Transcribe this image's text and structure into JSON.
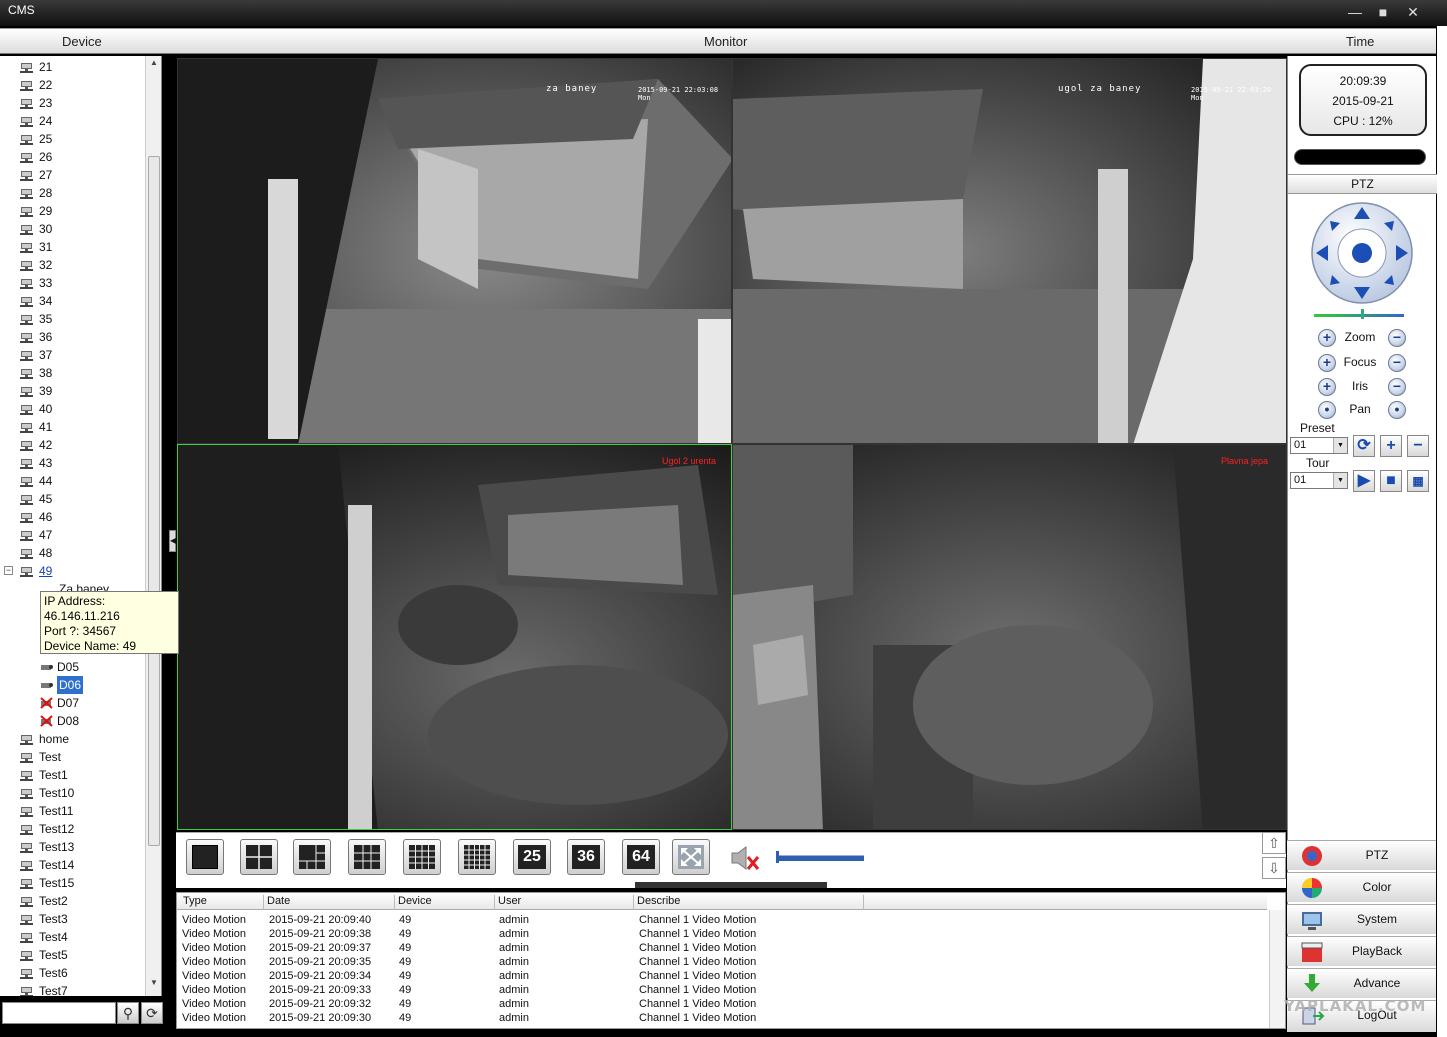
{
  "window": {
    "title": "CMS"
  },
  "header": {
    "device": "Device",
    "monitor": "Monitor",
    "time": "Time"
  },
  "tree": {
    "items": [
      "21",
      "22",
      "23",
      "24",
      "25",
      "26",
      "27",
      "28",
      "29",
      "30",
      "31",
      "32",
      "33",
      "34",
      "35",
      "36",
      "37",
      "38",
      "39",
      "40",
      "41",
      "42",
      "43",
      "44",
      "45",
      "46",
      "47",
      "48"
    ],
    "expanded": "49",
    "expanded_child": "Za baney",
    "channels": [
      "D05",
      "D06",
      "D07",
      "D08"
    ],
    "selected": "D06",
    "after": [
      "home",
      "Test",
      "Test1",
      "Test10",
      "Test11",
      "Test12",
      "Test13",
      "Test14",
      "Test15",
      "Test2",
      "Test3",
      "Test4",
      "Test5",
      "Test6",
      "Test7"
    ]
  },
  "tooltip": {
    "ip": "IP Address: 46.146.11.216",
    "port": "Port ?: 34567",
    "name": "Device Name: 49"
  },
  "cameras": [
    {
      "name": "za baney",
      "time": "2015-09-21 22:03:08 Mon"
    },
    {
      "name": "ugol za baney",
      "time": "2015-09-21 22:03:20 Mon"
    },
    {
      "name": "Ugol 2 urenta",
      "time": ""
    },
    {
      "name": "Plavna jepa",
      "time": ""
    }
  ],
  "layouts": [
    "25",
    "36",
    "64"
  ],
  "log": {
    "columns": [
      "Type",
      "Date",
      "Device",
      "User",
      "Describe"
    ],
    "rows": [
      [
        "Video Motion",
        "2015-09-21 20:09:40",
        "49",
        "admin",
        "Channel 1 Video Motion"
      ],
      [
        "Video Motion",
        "2015-09-21 20:09:38",
        "49",
        "admin",
        "Channel 1 Video Motion"
      ],
      [
        "Video Motion",
        "2015-09-21 20:09:37",
        "49",
        "admin",
        "Channel 1 Video Motion"
      ],
      [
        "Video Motion",
        "2015-09-21 20:09:35",
        "49",
        "admin",
        "Channel 1 Video Motion"
      ],
      [
        "Video Motion",
        "2015-09-21 20:09:34",
        "49",
        "admin",
        "Channel 1 Video Motion"
      ],
      [
        "Video Motion",
        "2015-09-21 20:09:33",
        "49",
        "admin",
        "Channel 1 Video Motion"
      ],
      [
        "Video Motion",
        "2015-09-21 20:09:32",
        "49",
        "admin",
        "Channel 1 Video Motion"
      ],
      [
        "Video Motion",
        "2015-09-21 20:09:30",
        "49",
        "admin",
        "Channel 1 Video Motion"
      ]
    ]
  },
  "clock": {
    "time": "20:09:39",
    "date": "2015-09-21",
    "cpu": "CPU : 12%"
  },
  "ptz": {
    "title": "PTZ",
    "zoom": "Zoom",
    "focus": "Focus",
    "iris": "Iris",
    "pan": "Pan",
    "preset_label": "Preset",
    "preset_value": "01",
    "tour_label": "Tour",
    "tour_value": "01"
  },
  "menu": [
    "PTZ",
    "Color",
    "System",
    "PlayBack",
    "Advance",
    "LogOut"
  ],
  "watermark": "YAPLAKAL.COM",
  "colors": {
    "active_border": "#3fd040",
    "osd_red": "#ff2020",
    "select": "#2f6fd0"
  }
}
